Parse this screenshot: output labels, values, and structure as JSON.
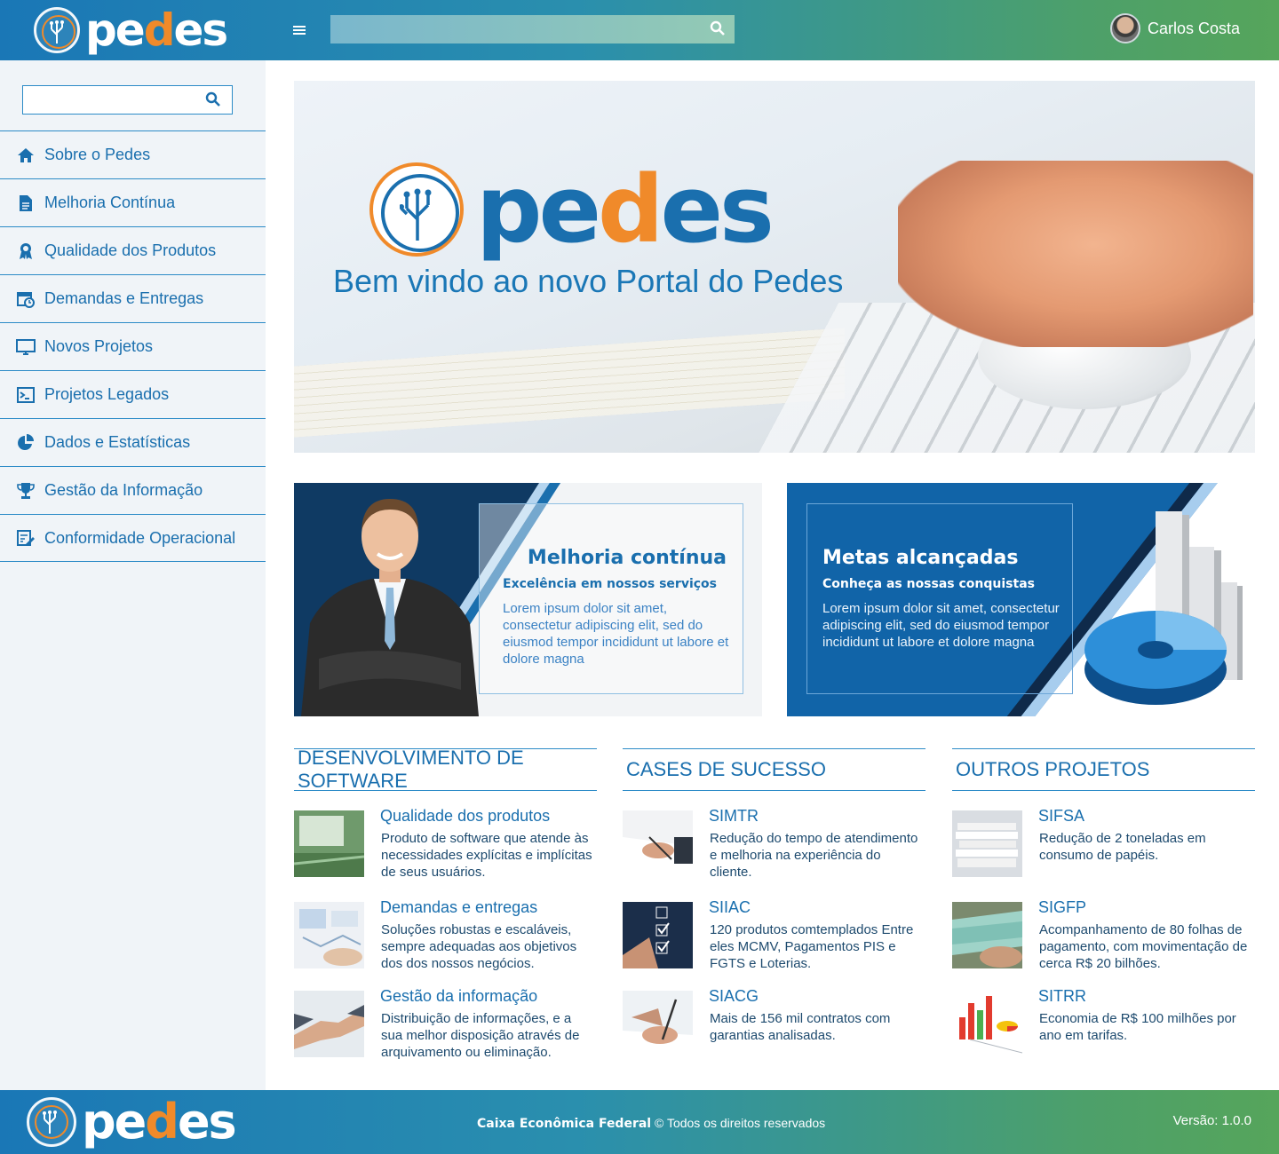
{
  "brand": {
    "name_pe": "pe",
    "name_d": "d",
    "name_es": "es"
  },
  "header": {
    "menu_icon": "hamburger-icon",
    "search_placeholder": "",
    "search_icon": "search-icon",
    "user_name": "Carlos Costa"
  },
  "sidebar": {
    "search_placeholder": "",
    "items": [
      {
        "label": "Sobre o Pedes",
        "icon": "home-icon"
      },
      {
        "label": "Melhoria Contínua",
        "icon": "document-icon"
      },
      {
        "label": "Qualidade dos Produtos",
        "icon": "award-ribbon-icon"
      },
      {
        "label": "Demandas e Entregas",
        "icon": "calendar-clock-icon"
      },
      {
        "label": "Novos Projetos",
        "icon": "monitor-icon"
      },
      {
        "label": "Projetos Legados",
        "icon": "terminal-icon"
      },
      {
        "label": "Dados e Estatísticas",
        "icon": "pie-chart-icon"
      },
      {
        "label": "Gestão da Informação",
        "icon": "trophy-icon"
      },
      {
        "label": "Conformidade Operacional",
        "icon": "checklist-edit-icon"
      }
    ]
  },
  "hero": {
    "title": "Bem vindo ao novo Portal do Pedes"
  },
  "cards": [
    {
      "title": "Melhoria contínua",
      "subtitle": "Excelência em nossos serviços",
      "text": "Lorem ipsum dolor sit amet, consectetur adipiscing elit, sed do eiusmod tempor incididunt ut labore et dolore magna"
    },
    {
      "title": "Metas alcançadas",
      "subtitle": "Conheça as nossas conquistas",
      "text": "Lorem ipsum dolor sit amet, consectetur adipiscing elit, sed do eiusmod tempor incididunt ut labore et dolore magna"
    }
  ],
  "sections": [
    {
      "heading": "DESENVOLVIMENTO DE SOFTWARE",
      "items": [
        {
          "title": "Qualidade dos produtos",
          "text": "Produto de software que atende às necessidades explícitas e implícitas de seus usuários."
        },
        {
          "title": "Demandas e entregas",
          "text": "Soluções robustas e escaláveis, sempre adequadas aos objetivos dos dos nossos negócios."
        },
        {
          "title": "Gestão da informação",
          "text": "Distribuição de informações, e a sua melhor disposição através de arquivamento ou eliminação."
        }
      ]
    },
    {
      "heading": "CASES DE SUCESSO",
      "items": [
        {
          "title": "SIMTR",
          "text": "Redução do tempo de atendimento e melhoria na experiência do cliente."
        },
        {
          "title": "SIIAC",
          "text": "120 produtos comtemplados Entre eles MCMV, Pagamentos PIS e FGTS e Loterias."
        },
        {
          "title": "SIACG",
          "text": "Mais de 156 mil contratos com garantias analisadas."
        }
      ]
    },
    {
      "heading": "OUTROS PROJETOS",
      "items": [
        {
          "title": "SIFSA",
          "text": "Redução de 2 toneladas em consumo de papéis."
        },
        {
          "title": "SIGFP",
          "text": "Acompanhamento de 80 folhas de pagamento, com movimentação de cerca R$ 20 bilhões."
        },
        {
          "title": "SITRR",
          "text": "Economia de R$ 100 milhões por ano em tarifas."
        }
      ]
    }
  ],
  "footer": {
    "company": "Caixa Econômica Federal",
    "rights": " © Todos os direitos reservados",
    "version": "Versão: 1.0.0"
  }
}
